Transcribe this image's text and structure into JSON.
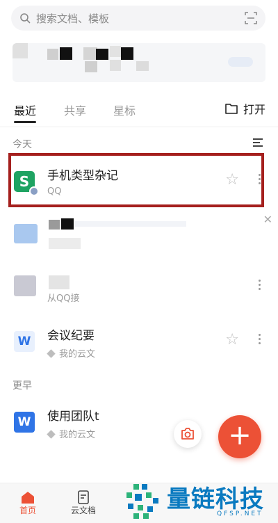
{
  "search": {
    "placeholder": "搜索文档、模板"
  },
  "tabs": [
    {
      "label": "最近"
    },
    {
      "label": "共享"
    },
    {
      "label": "星标"
    }
  ],
  "open_button": {
    "label": "打开"
  },
  "sections": {
    "today": "今天",
    "earlier": "更早"
  },
  "files": [
    {
      "title": "手机类型杂记",
      "subtitle": "QQ",
      "icon": "spreadsheet-icon"
    },
    {
      "title": "",
      "subtitle": "",
      "icon": "blurred-file-icon"
    },
    {
      "title": "",
      "subtitle": "从QQ接",
      "icon": "blurred-file-icon"
    },
    {
      "title": "会议纪要",
      "subtitle": "我的云文",
      "icon": "word-doc-icon"
    },
    {
      "title": "使用团队t",
      "subtitle": "我的云文",
      "icon": "word-doc-icon"
    }
  ],
  "bottom_nav": [
    {
      "label": "首页"
    },
    {
      "label": "云文档"
    }
  ],
  "fab": {
    "symbol": "+"
  },
  "watermark": {
    "text": "量链科技",
    "domain": "QFSP.NET"
  },
  "colors": {
    "accent": "#ec5136",
    "highlight": "#a5201e",
    "sheet_green": "#1ea362",
    "doc_blue": "#2f74e6"
  }
}
